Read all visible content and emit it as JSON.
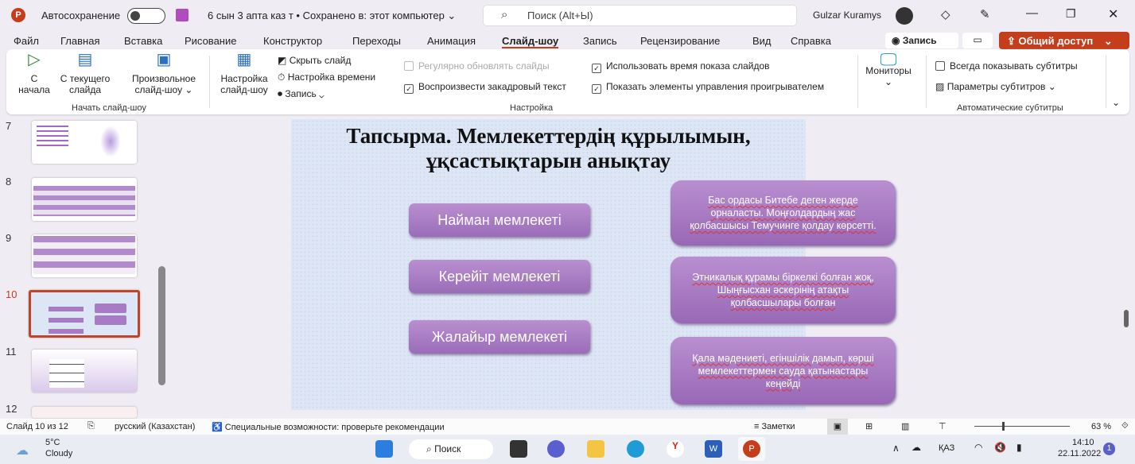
{
  "titlebar": {
    "autosave": "Автосохранение",
    "doc": "6 сын 3 апта каз т • Сохранено в: этот компьютер ⌄",
    "search": "Поиск (Alt+Ы)",
    "user": "Gulzar Kuramys"
  },
  "menu": [
    "Файл",
    "Главная",
    "Вставка",
    "Рисование",
    "Конструктор",
    "Переходы",
    "Анимация",
    "Слайд-шоу",
    "Запись",
    "Рецензирование",
    "Вид",
    "Справка"
  ],
  "actions": {
    "record": "Запись",
    "share": "Общий доступ"
  },
  "ribbon": {
    "from_start": "С\nначала",
    "from_current": "С текущего\nслайда",
    "custom": "Произвольное\nслайд-шоу ⌄",
    "group_start": "Начать слайд-шоу",
    "setup": "Настройка\nслайд-шоу",
    "hide": "Скрыть слайд",
    "timing": "Настройка времени",
    "rec": "Запись",
    "refresh": "Регулярно обновлять слайды",
    "narration": "Воспроизвести закадровый текст",
    "use_timings": "Использовать время показа слайдов",
    "controls": "Показать элементы управления проигрывателем",
    "group_setup": "Настройка",
    "monitors": "Мониторы",
    "always_subs": "Всегда показывать субтитры",
    "sub_params": "Параметры субтитров ⌄",
    "group_subs": "Автоматические субтитры",
    "checks": {
      "refresh": false,
      "narration": true,
      "use_timings": true,
      "controls": true,
      "always_subs": false
    }
  },
  "thumbs": [
    {
      "n": "7"
    },
    {
      "n": "8"
    },
    {
      "n": "9"
    },
    {
      "n": "10",
      "active": true
    },
    {
      "n": "11"
    },
    {
      "n": "12"
    }
  ],
  "slide": {
    "title": "Тапсырма. Мемлекеттердің құрылымын, ұқсастықтарын анықтау",
    "left": [
      "Найман мемлекеті",
      "Керейіт  мемлекеті",
      "Жалайыр мемлекеті"
    ],
    "right": [
      "Бас ордасы Битебе деген жерде орналасты. Моңғолдардың жас қолбасшысы Темучинге қолдау көрсетті.",
      "Этникалық құрамы біркелкі болған жоқ, Шыңғысхан әскерінің атақты қолбасшылары болған",
      "Қала мәдениеті, егіншілік дамып, көрші мемлекеттермен сауда қатынастары кеңейді"
    ]
  },
  "status": {
    "slide": "Слайд 10 из 12",
    "lang": "русский (Казахстан)",
    "access": "Специальные возможности: проверьте рекомендации",
    "notes": "Заметки",
    "zoom": "63 %"
  },
  "taskbar": {
    "temp": "5°C",
    "weather": "Cloudy",
    "search": "Поиск",
    "lang": "ҚАЗ",
    "time": "14:10",
    "date": "22.11.2022",
    "badge": "1"
  },
  "colors": {
    "accent": "#c43e1c",
    "box": "#a87cc4"
  }
}
